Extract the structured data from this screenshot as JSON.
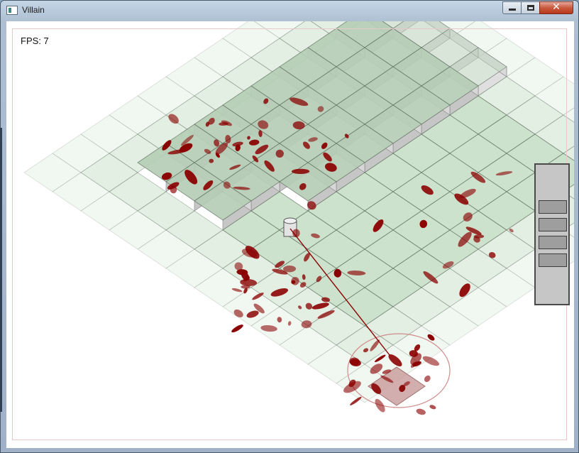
{
  "window": {
    "title": "Villain"
  },
  "hud": {
    "fps_label": "FPS: 7"
  },
  "controls": {
    "minimize": "minimize",
    "maximize": "maximize",
    "close": "close"
  },
  "side_panel": {
    "buttons": 4
  },
  "colors": {
    "blood": "#8a0000",
    "tile": "#c8dfc8",
    "tile_raised": "#b4ccb4"
  }
}
